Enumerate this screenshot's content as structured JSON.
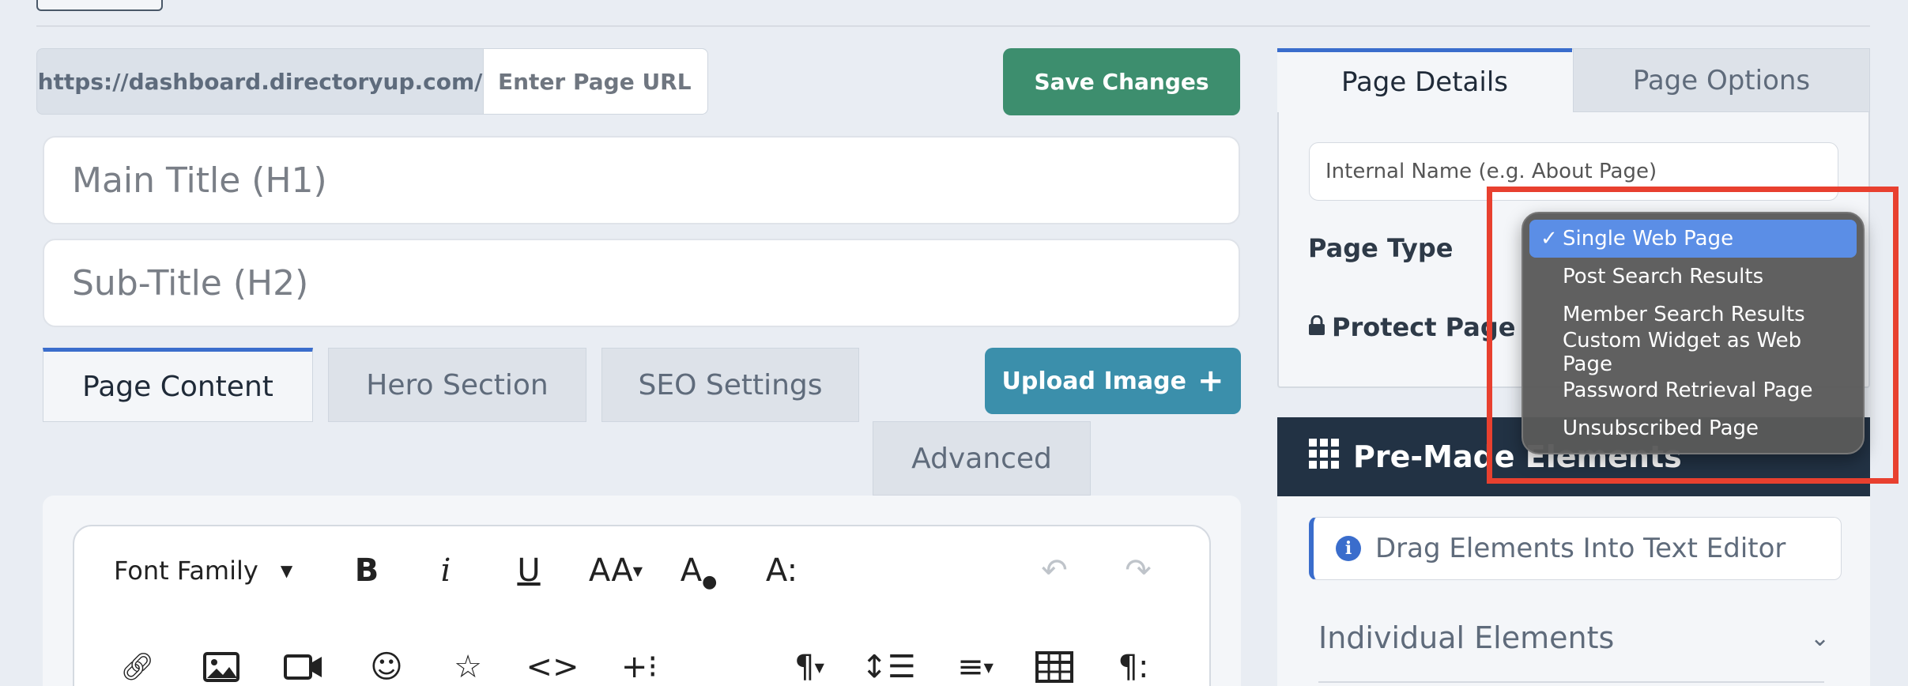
{
  "url_bar": {
    "prefix": "https://dashboard.directoryup.com/",
    "placeholder": "Enter Page URL"
  },
  "buttons": {
    "save": "Save Changes",
    "upload_image": "Upload Image"
  },
  "fields": {
    "main_title_placeholder": "Main Title (H1)",
    "subtitle_placeholder": "Sub-Title (H2)"
  },
  "content_tabs": [
    {
      "label": "Page Content",
      "active": true
    },
    {
      "label": "Hero Section",
      "active": false
    },
    {
      "label": "SEO Settings",
      "active": false
    },
    {
      "label": "Advanced",
      "active": false
    }
  ],
  "toolbar": {
    "font_family": "Font Family",
    "bold": "B",
    "italic": "i",
    "underline": "U",
    "font_size": "AA",
    "text_color_letter": "A",
    "paragraph_style": "A:",
    "paragraph_format": "¶",
    "more": "¶:"
  },
  "right_panel": {
    "tabs": [
      {
        "label": "Page Details",
        "active": true
      },
      {
        "label": "Page Options",
        "active": false
      }
    ],
    "internal_name_placeholder": "Internal Name (e.g. About Page)",
    "page_type_label": "Page Type",
    "protect_page_label": "Protect Page"
  },
  "page_type_dropdown": {
    "selected": "Single Web Page",
    "options": [
      "Single Web Page",
      "Post Search Results",
      "Member Search Results",
      "Custom Widget as Web Page",
      "Password Retrieval Page",
      "Unsubscribed Page"
    ]
  },
  "premade": {
    "title": "Pre-Made Elements",
    "hint": "Drag Elements Into Text Editor",
    "individual": "Individual Elements"
  },
  "colors": {
    "accent_blue": "#3a6dcc",
    "save_green": "#3d8e6e",
    "upload_teal": "#3b8fab",
    "dark_header": "#223244",
    "highlight_red": "#e8402f"
  }
}
